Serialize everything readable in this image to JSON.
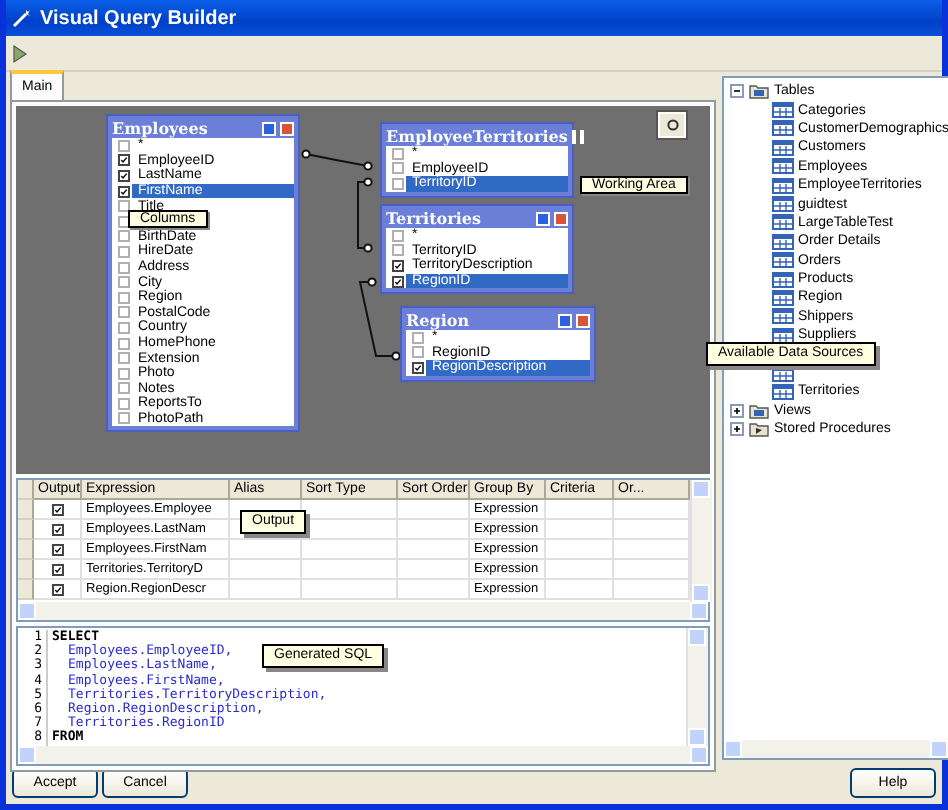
{
  "window": {
    "title": "Visual Query Builder"
  },
  "tabs": [
    {
      "label": "Main",
      "selected": true
    }
  ],
  "canvas": {
    "tables": [
      {
        "title": "Employees",
        "columns": [
          {
            "label": "*",
            "checked": false,
            "selected": false
          },
          {
            "label": "EmployeeID",
            "checked": true,
            "selected": false
          },
          {
            "label": "LastName",
            "checked": true,
            "selected": false
          },
          {
            "label": "FirstName",
            "checked": true,
            "selected": true
          },
          {
            "label": "Title",
            "checked": false,
            "selected": false
          },
          {
            "checked": false,
            "selected": false
          },
          {
            "label": "BirthDate",
            "checked": false,
            "selected": false
          },
          {
            "label": "HireDate",
            "checked": false,
            "selected": false
          },
          {
            "label": "Address",
            "checked": false,
            "selected": false
          },
          {
            "label": "City",
            "checked": false,
            "selected": false
          },
          {
            "label": "Region",
            "checked": false,
            "selected": false
          },
          {
            "label": "PostalCode",
            "checked": false,
            "selected": false
          },
          {
            "label": "Country",
            "checked": false,
            "selected": false
          },
          {
            "label": "HomePhone",
            "checked": false,
            "selected": false
          },
          {
            "label": "Extension",
            "checked": false,
            "selected": false
          },
          {
            "label": "Photo",
            "checked": false,
            "selected": false
          },
          {
            "label": "Notes",
            "checked": false,
            "selected": false
          },
          {
            "label": "ReportsTo",
            "checked": false,
            "selected": false
          },
          {
            "label": "PhotoPath",
            "checked": false,
            "selected": false
          }
        ]
      },
      {
        "title": "EmployeeTerritories",
        "columns": [
          {
            "label": "*",
            "checked": false,
            "selected": false
          },
          {
            "label": "EmployeeID",
            "checked": false,
            "selected": false
          },
          {
            "label": "TerritoryID",
            "checked": false,
            "selected": true
          }
        ]
      },
      {
        "title": "Territories",
        "columns": [
          {
            "label": "*",
            "checked": false,
            "selected": false
          },
          {
            "label": "TerritoryID",
            "checked": false,
            "selected": false
          },
          {
            "label": "TerritoryDescription",
            "checked": true,
            "selected": false
          },
          {
            "label": "RegionID",
            "checked": true,
            "selected": true
          }
        ]
      },
      {
        "title": "Region",
        "columns": [
          {
            "label": "*",
            "checked": false,
            "selected": false
          },
          {
            "label": "RegionID",
            "checked": false,
            "selected": false
          },
          {
            "label": "RegionDescription",
            "checked": true,
            "selected": true
          }
        ]
      }
    ],
    "callouts": [
      "Columns",
      "Working Area"
    ]
  },
  "grid": {
    "columns": [
      "Output",
      "Expression",
      "Alias",
      "Sort Type",
      "Sort Order",
      "Group By",
      "Criteria",
      "Or..."
    ],
    "rows": [
      {
        "output": true,
        "expression": "Employees.Employee",
        "group_by": "Expression"
      },
      {
        "output": true,
        "expression": "Employees.LastNam",
        "group_by": "Expression"
      },
      {
        "output": true,
        "expression": "Employees.FirstNam",
        "group_by": "Expression"
      },
      {
        "output": true,
        "expression": "Territories.TerritoryD",
        "group_by": "Expression"
      },
      {
        "output": true,
        "expression": "Region.RegionDescr",
        "group_by": "Expression"
      }
    ],
    "callout": "Output"
  },
  "sql": {
    "lines": [
      {
        "number": "1",
        "text": "SELECT",
        "kind": "keyword"
      },
      {
        "number": "2",
        "text": "Employees.EmployeeID,",
        "kind": "field"
      },
      {
        "number": "3",
        "text": "Employees.LastName,",
        "kind": "field"
      },
      {
        "number": "4",
        "text": "Employees.FirstName,",
        "kind": "field"
      },
      {
        "number": "5",
        "text": "Territories.TerritoryDescription,",
        "kind": "field"
      },
      {
        "number": "6",
        "text": "Region.RegionDescription,",
        "kind": "field"
      },
      {
        "number": "7",
        "text": "Territories.RegionID",
        "kind": "field"
      },
      {
        "number": "8",
        "text": "FROM",
        "kind": "keyword"
      }
    ],
    "callout": "Generated SQL"
  },
  "tree": {
    "items": [
      {
        "label": "Tables",
        "expanded": true,
        "children": [
          {
            "label": "Categories"
          },
          {
            "label": "CustomerDemographics"
          },
          {
            "label": "Customers"
          },
          {
            "label": "Employees"
          },
          {
            "label": "EmployeeTerritories"
          },
          {
            "label": "guidtest"
          },
          {
            "label": "LargeTableTest"
          },
          {
            "label": "Order Details"
          },
          {
            "label": "Orders"
          },
          {
            "label": "Products"
          },
          {
            "label": "Region"
          },
          {
            "label": "Shippers"
          },
          {
            "label": "Suppliers"
          },
          {
            "kind": "table"
          },
          {
            "label": "Territories"
          }
        ]
      },
      {
        "label": "Views",
        "expanded": false
      },
      {
        "label": "Stored Procedures",
        "expanded": false
      }
    ],
    "callout": "Available Data Sources"
  },
  "buttons": {
    "left": [
      "Accept",
      "Cancel"
    ],
    "right": [
      "Help"
    ]
  }
}
